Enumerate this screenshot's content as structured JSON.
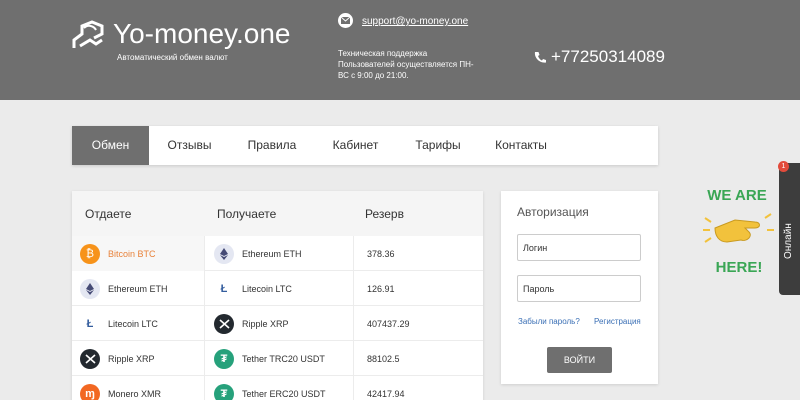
{
  "header": {
    "logo_title": "Yo-money.one",
    "logo_subtitle": "Автоматический обмен валют",
    "email": "support@yo-money.one",
    "support_text": "Техническая поддержка Пользователей осуществляется ПН-ВС с 9:00 до 21:00.",
    "phone": "+77250314089"
  },
  "nav": {
    "items": [
      "Обмен",
      "Отзывы",
      "Правила",
      "Кабинет",
      "Тарифы",
      "Контакты"
    ],
    "active": "Обмен"
  },
  "exchange": {
    "columns": {
      "give": "Отдаете",
      "get": "Получаете",
      "reserve": "Резерв"
    },
    "rows": [
      {
        "give": "Bitcoin BTC",
        "give_icon": "bitcoin-icon",
        "get": "Ethereum ETH",
        "get_icon": "ethereum-icon",
        "reserve": "378.36"
      },
      {
        "give": "Ethereum ETH",
        "give_icon": "ethereum-icon",
        "get": "Litecoin LTC",
        "get_icon": "litecoin-icon",
        "reserve": "126.91"
      },
      {
        "give": "Litecoin LTC",
        "give_icon": "litecoin-icon",
        "get": "Ripple XRP",
        "get_icon": "ripple-icon",
        "reserve": "407437.29"
      },
      {
        "give": "Ripple XRP",
        "give_icon": "ripple-icon",
        "get": "Tether TRC20 USDT",
        "get_icon": "tether-icon",
        "reserve": "88102.5"
      },
      {
        "give": "Monero XMR",
        "give_icon": "monero-icon",
        "get": "Tether ERC20 USDT",
        "get_icon": "tether-icon",
        "reserve": "42417.94"
      }
    ]
  },
  "auth": {
    "title": "Авторизация",
    "login_placeholder": "Логин",
    "password_placeholder": "Пароль",
    "forgot_link": "Забыли пароль?",
    "register_link": "Регистрация",
    "submit_label": "ВОЙТИ"
  },
  "widget": {
    "line1": "WE ARE",
    "line2": "HERE!",
    "online_label": "Онлайн",
    "badge_count": "1"
  },
  "colors": {
    "header_bg": "#6f6f6f",
    "page_bg": "#ebebeb",
    "accent_orange": "#e8823a",
    "link_blue": "#3a6fb5",
    "widget_green": "#3aa655",
    "widget_yellow": "#f2c23c"
  }
}
